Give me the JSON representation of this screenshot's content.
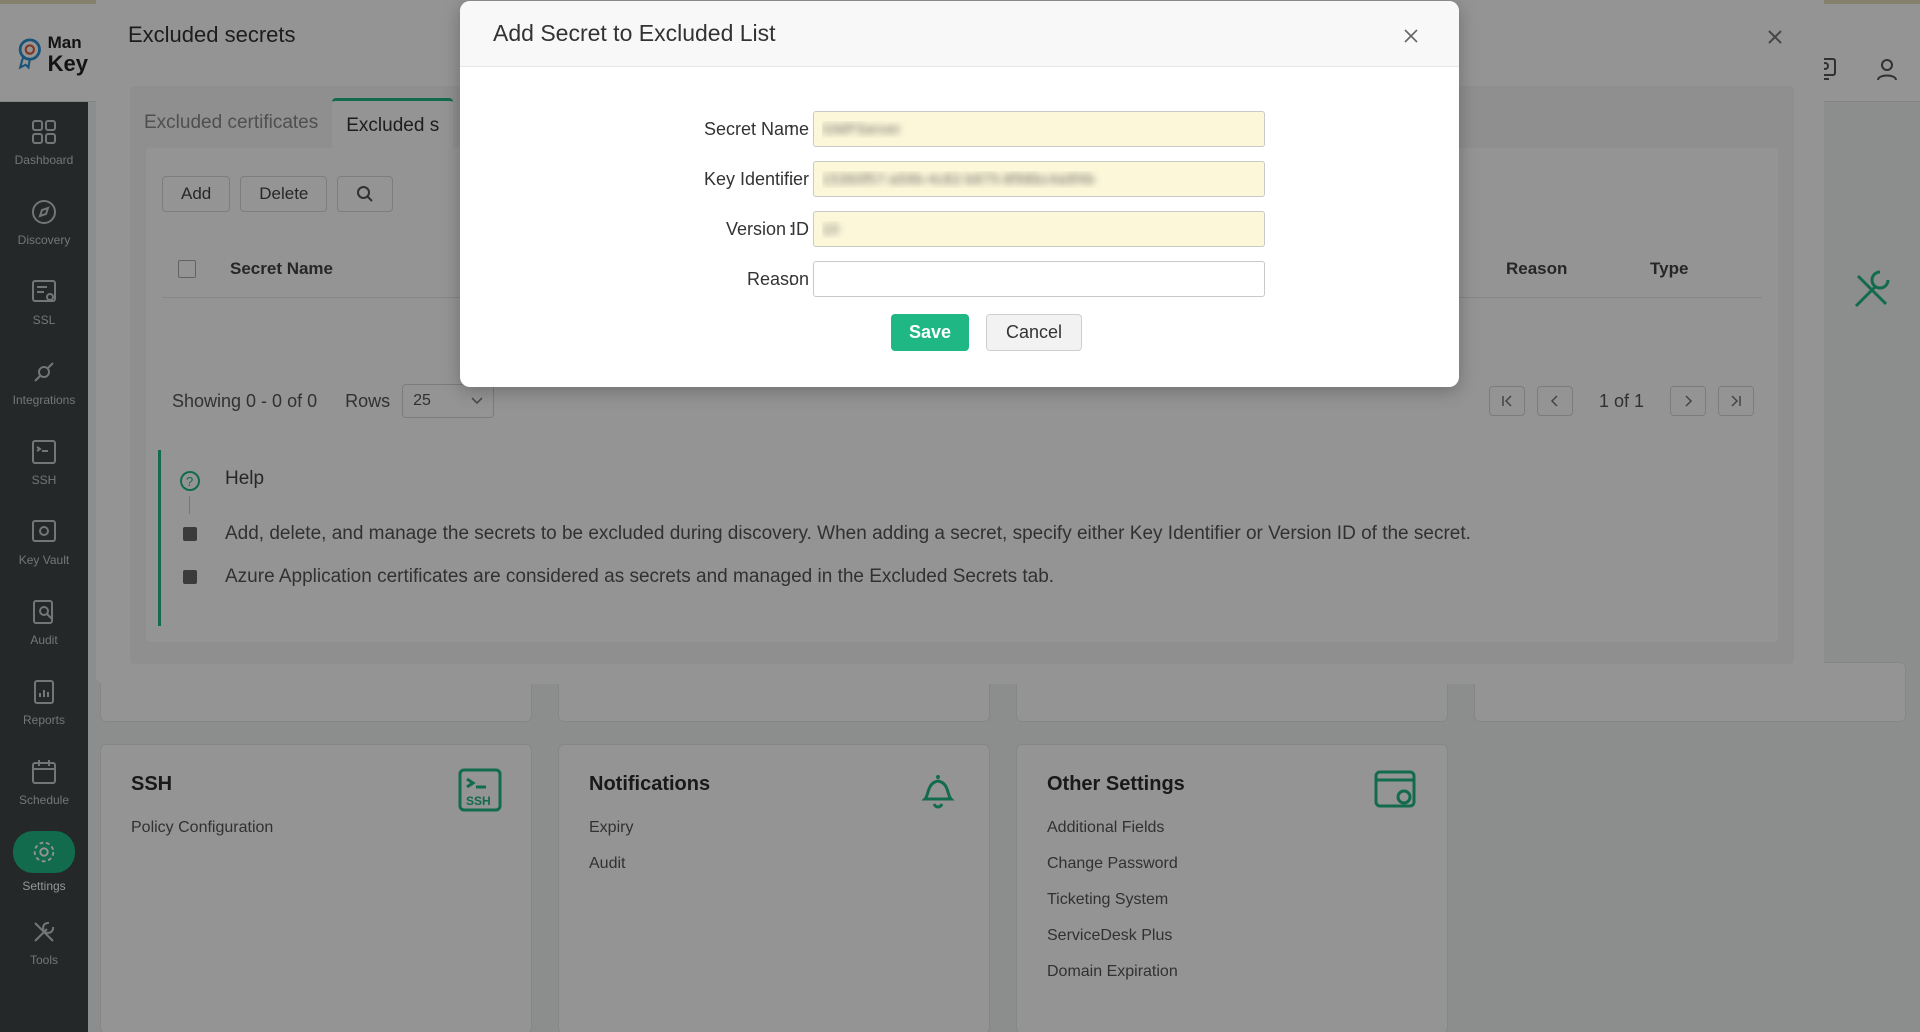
{
  "app": {
    "logo_line1": "Man",
    "logo_line2": "Key"
  },
  "sidebar": {
    "items": [
      {
        "label": "Dashboard",
        "icon": "dashboard-icon"
      },
      {
        "label": "Discovery",
        "icon": "discovery-icon"
      },
      {
        "label": "SSL",
        "icon": "ssl-icon"
      },
      {
        "label": "Integrations",
        "icon": "integrations-icon"
      },
      {
        "label": "SSH",
        "icon": "ssh-icon"
      },
      {
        "label": "Key Vault",
        "icon": "key-vault-icon"
      },
      {
        "label": "Audit",
        "icon": "audit-icon"
      },
      {
        "label": "Reports",
        "icon": "reports-icon"
      },
      {
        "label": "Schedule",
        "icon": "schedule-icon"
      },
      {
        "label": "Settings",
        "icon": "gear-icon",
        "active": true
      },
      {
        "label": "Tools",
        "icon": "tools-icon"
      }
    ]
  },
  "cards": {
    "ssh": {
      "title": "SSH",
      "links": [
        "Policy Configuration"
      ]
    },
    "notifications": {
      "title": "Notifications",
      "links": [
        "Expiry",
        "Audit"
      ]
    },
    "other": {
      "title": "Other Settings",
      "links": [
        "Additional Fields",
        "Change Password",
        "Ticketing System",
        "ServiceDesk Plus",
        "Domain Expiration"
      ]
    }
  },
  "panel": {
    "title": "Excluded secrets",
    "tabs": [
      "Excluded certificates",
      "Excluded s"
    ],
    "toolbar": {
      "add": "Add",
      "delete": "Delete"
    },
    "columns": {
      "secret_name": "Secret Name",
      "reason": "Reason",
      "type": "Type"
    },
    "pager": {
      "showing": "Showing 0 - 0 of 0",
      "rows_label": "Rows",
      "rows_value": "25",
      "page": "1 of 1"
    },
    "help": {
      "title": "Help",
      "items": [
        "Add, delete, and manage the secrets to be excluded during discovery. When adding a secret, specify either Key Identifier or Version ID of the secret.",
        "Azure Application certificates are considered as secrets and managed in the Excluded Secrets tab."
      ]
    }
  },
  "modal": {
    "title": "Add Secret to Excluded List",
    "fields": {
      "secret_name": {
        "label": "Secret Name",
        "value": "GMPServer"
      },
      "key_identifier": {
        "label": "Key Identifier",
        "value": "15360f57-a59b-4c82-b875-8f98bc4a9f4b"
      },
      "version_id": {
        "label": "Version ID",
        "value": "10"
      },
      "reason": {
        "label": "Reason",
        "value": ""
      }
    },
    "colon": ":",
    "save": "Save",
    "cancel": "Cancel"
  },
  "colors": {
    "accent": "#1fb885",
    "sidebar": "#3f4546",
    "input_autofill": "#fdf7da"
  }
}
